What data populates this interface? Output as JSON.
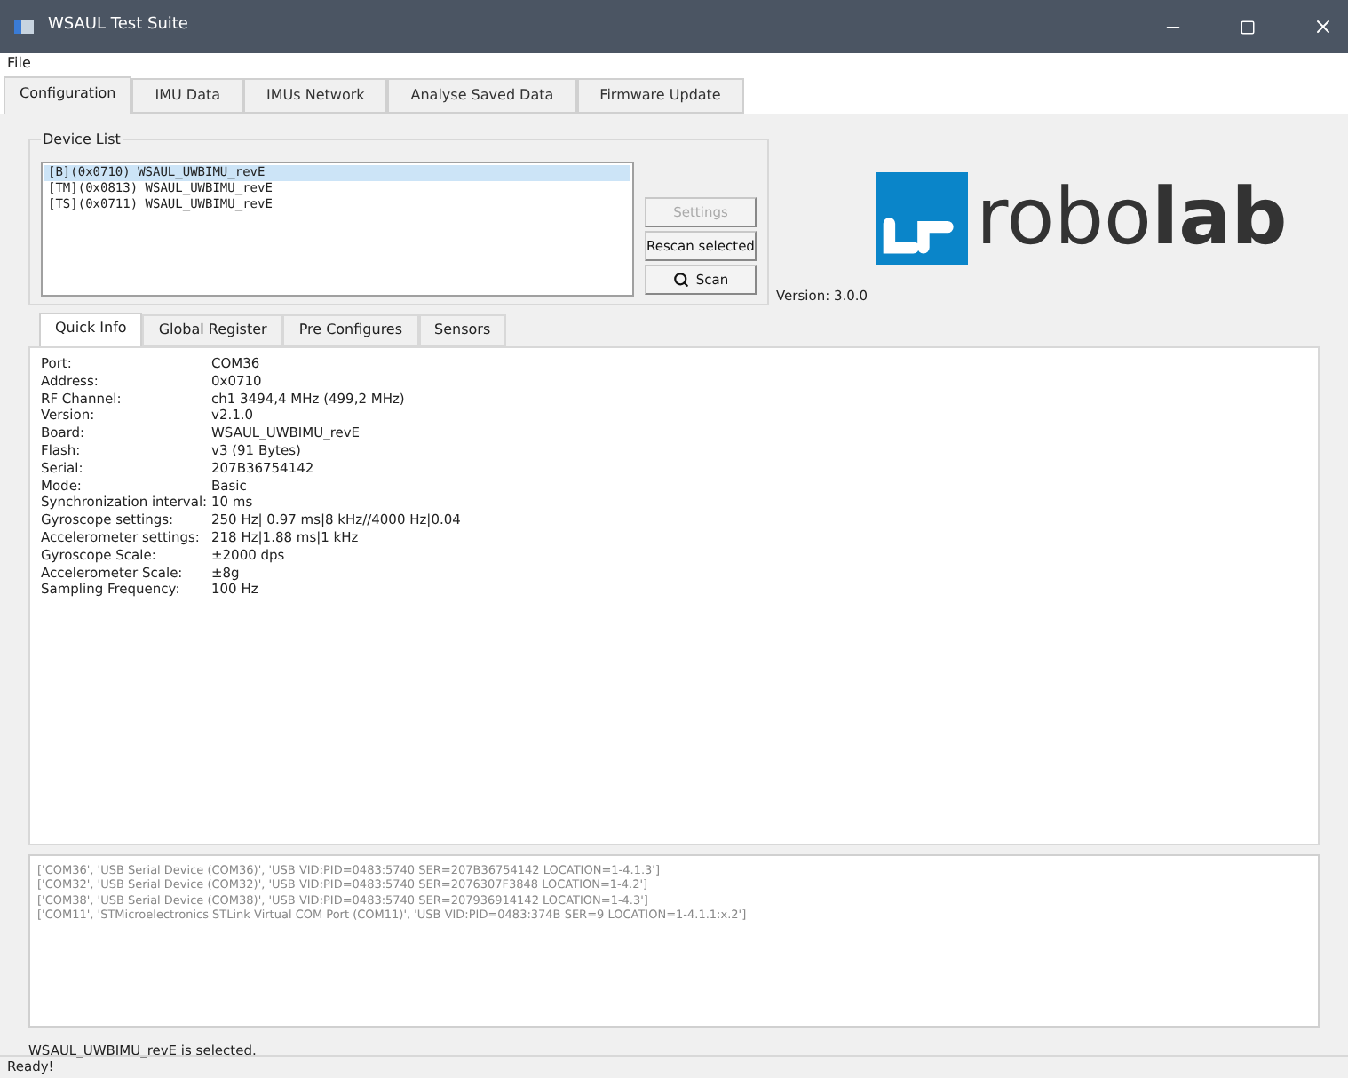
{
  "window": {
    "title": "WSAUL Test Suite"
  },
  "menu": [
    "File"
  ],
  "tabs": [
    {
      "label": "Configuration",
      "selected": true
    },
    {
      "label": "IMU Data",
      "selected": false
    },
    {
      "label": "IMUs Network",
      "selected": false
    },
    {
      "label": "Analyse Saved Data",
      "selected": false
    },
    {
      "label": "Firmware Update",
      "selected": false
    }
  ],
  "device_list": {
    "title": "Device List",
    "items": [
      {
        "label": "[B](0x0710) WSAUL_UWBIMU_revE",
        "selected": true
      },
      {
        "label": "[TM](0x0813) WSAUL_UWBIMU_revE",
        "selected": false
      },
      {
        "label": "[TS](0x0711) WSAUL_UWBIMU_revE",
        "selected": false
      }
    ],
    "buttons": [
      {
        "label": "Settings",
        "disabled": true,
        "kind": "plain"
      },
      {
        "label": "Rescan selected",
        "disabled": false,
        "kind": "plain"
      },
      {
        "label": "Scan",
        "disabled": false,
        "kind": "search"
      }
    ]
  },
  "version": "Version: 3.0.0",
  "logo": {
    "text": "robo**lab**"
  },
  "sub_tabs": [
    {
      "label": "Quick Info",
      "selected": true
    },
    {
      "label": "Global Register",
      "selected": false
    },
    {
      "label": "Pre Configures",
      "selected": false
    },
    {
      "label": "Sensors",
      "selected": false
    }
  ],
  "quick_info": [
    {
      "label": "Port:",
      "value": "COM36"
    },
    {
      "label": "Address:",
      "value": "0x0710"
    },
    {
      "label": "RF Channel:",
      "value": "ch1 3494,4 MHz (499,2 MHz)"
    },
    {
      "label": "Version:",
      "value": "v2.1.0"
    },
    {
      "label": "Board:",
      "value": "WSAUL_UWBIMU_revE"
    },
    {
      "label": "Flash:",
      "value": "v3 (91 Bytes)"
    },
    {
      "label": "Serial:",
      "value": "207B36754142"
    },
    {
      "label": "Mode:",
      "value": "Basic"
    },
    {
      "label": "Synchronization interval:",
      "value": "10 ms"
    },
    {
      "label": "Gyroscope settings:",
      "value": "250 Hz| 0.97 ms|8 kHz//4000 Hz|0.04"
    },
    {
      "label": "Accelerometer settings:",
      "value": "218 Hz|1.88 ms|1 kHz"
    },
    {
      "label": "Gyroscope Scale:",
      "value": "±2000 dps"
    },
    {
      "label": "Accelerometer Scale:",
      "value": "±8g"
    },
    {
      "label": "Sampling Frequency:",
      "value": "100 Hz"
    }
  ],
  "port_log": [
    "['COM36', 'USB Serial Device (COM36)', 'USB VID:PID=0483:5740 SER=207B36754142 LOCATION=1-4.1.3']",
    "['COM32', 'USB Serial Device (COM32)', 'USB VID:PID=0483:5740 SER=2076307F3848 LOCATION=1-4.2']",
    "['COM38', 'USB Serial Device (COM38)', 'USB VID:PID=0483:5740 SER=207936914142 LOCATION=1-4.3']",
    "['COM11', 'STMicroelectronics STLink Virtual COM Port (COM11)', 'USB VID:PID=0483:374B SER=9 LOCATION=1-4.1.1:x.2']"
  ],
  "selection_message": "WSAUL_UWBIMU_revE is selected.",
  "status_bar": "Ready!"
}
